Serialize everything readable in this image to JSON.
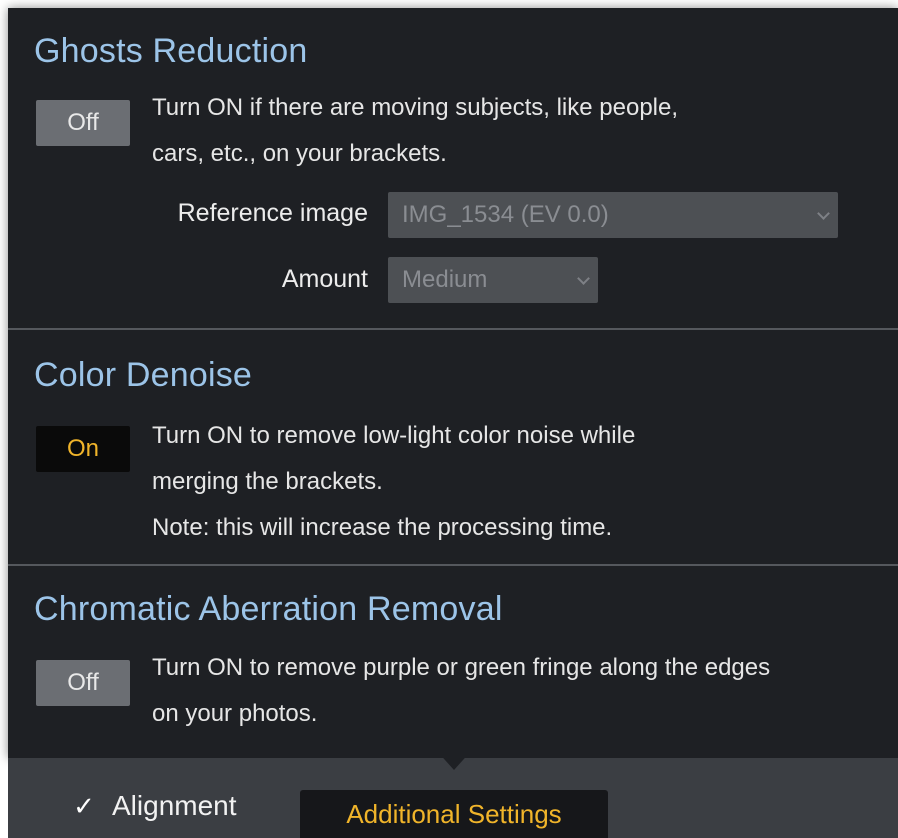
{
  "ghosts": {
    "title": "Ghosts Reduction",
    "toggle": "Off",
    "description": [
      "Turn ON if there are moving subjects, like people,",
      "cars, etc., on your brackets."
    ],
    "reference_label": "Reference image",
    "reference_value": "IMG_1534 (EV 0.0)",
    "amount_label": "Amount",
    "amount_value": "Medium"
  },
  "denoise": {
    "title": "Color Denoise",
    "toggle": "On",
    "description": [
      "Turn ON to remove low-light color noise while",
      "merging the brackets.",
      "Note: this will increase the processing time."
    ]
  },
  "chromatic": {
    "title": "Chromatic Aberration Removal",
    "toggle": "Off",
    "description": [
      "Turn ON to remove purple or green fringe along the edges",
      "on your photos."
    ]
  },
  "bottom": {
    "checkmark": "✓",
    "alignment_label": "Alignment",
    "additional_settings_label": "Additional Settings"
  },
  "colors": {
    "panel_bg": "#1e2024",
    "title_blue": "#9cc4e8",
    "accent_orange": "#f0b42a",
    "toggle_off_bg": "#6b6e73",
    "toggle_on_bg": "#0a0a0a",
    "select_bg": "#4d5054"
  },
  "icons": {
    "dropdown": "chevron-down-icon",
    "check": "checkmark-icon"
  }
}
